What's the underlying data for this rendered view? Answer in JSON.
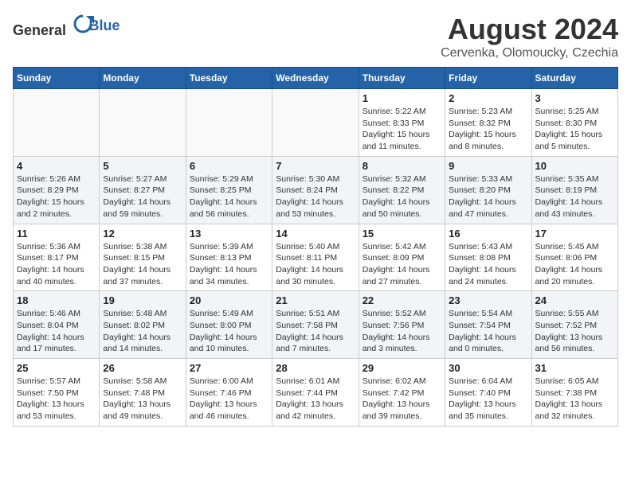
{
  "header": {
    "logo_general": "General",
    "logo_blue": "Blue",
    "title": "August 2024",
    "subtitle": "Cervenka, Olomoucky, Czechia"
  },
  "weekdays": [
    "Sunday",
    "Monday",
    "Tuesday",
    "Wednesday",
    "Thursday",
    "Friday",
    "Saturday"
  ],
  "weeks": [
    [
      {
        "day": "",
        "info": ""
      },
      {
        "day": "",
        "info": ""
      },
      {
        "day": "",
        "info": ""
      },
      {
        "day": "",
        "info": ""
      },
      {
        "day": "1",
        "info": "Sunrise: 5:22 AM\nSunset: 8:33 PM\nDaylight: 15 hours\nand 11 minutes."
      },
      {
        "day": "2",
        "info": "Sunrise: 5:23 AM\nSunset: 8:32 PM\nDaylight: 15 hours\nand 8 minutes."
      },
      {
        "day": "3",
        "info": "Sunrise: 5:25 AM\nSunset: 8:30 PM\nDaylight: 15 hours\nand 5 minutes."
      }
    ],
    [
      {
        "day": "4",
        "info": "Sunrise: 5:26 AM\nSunset: 8:29 PM\nDaylight: 15 hours\nand 2 minutes."
      },
      {
        "day": "5",
        "info": "Sunrise: 5:27 AM\nSunset: 8:27 PM\nDaylight: 14 hours\nand 59 minutes."
      },
      {
        "day": "6",
        "info": "Sunrise: 5:29 AM\nSunset: 8:25 PM\nDaylight: 14 hours\nand 56 minutes."
      },
      {
        "day": "7",
        "info": "Sunrise: 5:30 AM\nSunset: 8:24 PM\nDaylight: 14 hours\nand 53 minutes."
      },
      {
        "day": "8",
        "info": "Sunrise: 5:32 AM\nSunset: 8:22 PM\nDaylight: 14 hours\nand 50 minutes."
      },
      {
        "day": "9",
        "info": "Sunrise: 5:33 AM\nSunset: 8:20 PM\nDaylight: 14 hours\nand 47 minutes."
      },
      {
        "day": "10",
        "info": "Sunrise: 5:35 AM\nSunset: 8:19 PM\nDaylight: 14 hours\nand 43 minutes."
      }
    ],
    [
      {
        "day": "11",
        "info": "Sunrise: 5:36 AM\nSunset: 8:17 PM\nDaylight: 14 hours\nand 40 minutes."
      },
      {
        "day": "12",
        "info": "Sunrise: 5:38 AM\nSunset: 8:15 PM\nDaylight: 14 hours\nand 37 minutes."
      },
      {
        "day": "13",
        "info": "Sunrise: 5:39 AM\nSunset: 8:13 PM\nDaylight: 14 hours\nand 34 minutes."
      },
      {
        "day": "14",
        "info": "Sunrise: 5:40 AM\nSunset: 8:11 PM\nDaylight: 14 hours\nand 30 minutes."
      },
      {
        "day": "15",
        "info": "Sunrise: 5:42 AM\nSunset: 8:09 PM\nDaylight: 14 hours\nand 27 minutes."
      },
      {
        "day": "16",
        "info": "Sunrise: 5:43 AM\nSunset: 8:08 PM\nDaylight: 14 hours\nand 24 minutes."
      },
      {
        "day": "17",
        "info": "Sunrise: 5:45 AM\nSunset: 8:06 PM\nDaylight: 14 hours\nand 20 minutes."
      }
    ],
    [
      {
        "day": "18",
        "info": "Sunrise: 5:46 AM\nSunset: 8:04 PM\nDaylight: 14 hours\nand 17 minutes."
      },
      {
        "day": "19",
        "info": "Sunrise: 5:48 AM\nSunset: 8:02 PM\nDaylight: 14 hours\nand 14 minutes."
      },
      {
        "day": "20",
        "info": "Sunrise: 5:49 AM\nSunset: 8:00 PM\nDaylight: 14 hours\nand 10 minutes."
      },
      {
        "day": "21",
        "info": "Sunrise: 5:51 AM\nSunset: 7:58 PM\nDaylight: 14 hours\nand 7 minutes."
      },
      {
        "day": "22",
        "info": "Sunrise: 5:52 AM\nSunset: 7:56 PM\nDaylight: 14 hours\nand 3 minutes."
      },
      {
        "day": "23",
        "info": "Sunrise: 5:54 AM\nSunset: 7:54 PM\nDaylight: 14 hours\nand 0 minutes."
      },
      {
        "day": "24",
        "info": "Sunrise: 5:55 AM\nSunset: 7:52 PM\nDaylight: 13 hours\nand 56 minutes."
      }
    ],
    [
      {
        "day": "25",
        "info": "Sunrise: 5:57 AM\nSunset: 7:50 PM\nDaylight: 13 hours\nand 53 minutes."
      },
      {
        "day": "26",
        "info": "Sunrise: 5:58 AM\nSunset: 7:48 PM\nDaylight: 13 hours\nand 49 minutes."
      },
      {
        "day": "27",
        "info": "Sunrise: 6:00 AM\nSunset: 7:46 PM\nDaylight: 13 hours\nand 46 minutes."
      },
      {
        "day": "28",
        "info": "Sunrise: 6:01 AM\nSunset: 7:44 PM\nDaylight: 13 hours\nand 42 minutes."
      },
      {
        "day": "29",
        "info": "Sunrise: 6:02 AM\nSunset: 7:42 PM\nDaylight: 13 hours\nand 39 minutes."
      },
      {
        "day": "30",
        "info": "Sunrise: 6:04 AM\nSunset: 7:40 PM\nDaylight: 13 hours\nand 35 minutes."
      },
      {
        "day": "31",
        "info": "Sunrise: 6:05 AM\nSunset: 7:38 PM\nDaylight: 13 hours\nand 32 minutes."
      }
    ]
  ]
}
